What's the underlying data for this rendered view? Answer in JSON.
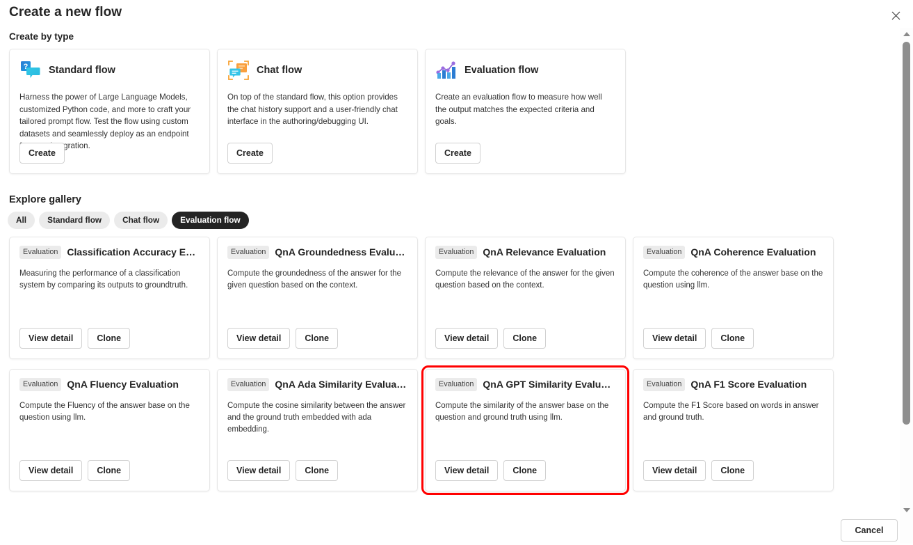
{
  "dialog": {
    "title": "Create a new flow",
    "close_label": "Close",
    "cancel_label": "Cancel"
  },
  "create_by_type": {
    "section_label": "Create by type",
    "cards": [
      {
        "icon": "question-speech-bubble-icon",
        "name": "Standard flow",
        "description": "Harness the power of Large Language Models, customized Python code, and more to craft your tailored prompt flow. Test the flow using custom datasets and seamlessly deploy as an endpoint for easy integration.",
        "button": "Create"
      },
      {
        "icon": "chat-bubbles-icon",
        "name": "Chat flow",
        "description": "On top of the standard flow, this option provides the chat history support and a user-friendly chat interface in the authoring/debugging UI.",
        "button": "Create"
      },
      {
        "icon": "bar-chart-line-icon",
        "name": "Evaluation flow",
        "description": "Create an evaluation flow to measure how well the output matches the expected criteria and goals.",
        "button": "Create"
      }
    ]
  },
  "explore_gallery": {
    "section_label": "Explore gallery",
    "filters": [
      {
        "label": "All",
        "selected": false
      },
      {
        "label": "Standard flow",
        "selected": false
      },
      {
        "label": "Chat flow",
        "selected": false
      },
      {
        "label": "Evaluation flow",
        "selected": true
      }
    ],
    "actions": {
      "view_detail": "View detail",
      "clone": "Clone"
    },
    "cards": [
      {
        "badge": "Evaluation",
        "title": "Classification Accuracy Evalu...",
        "description": "Measuring the performance of a classification system by comparing its outputs to groundtruth.",
        "view_detail": "View detail",
        "clone": "Clone",
        "highlighted": false
      },
      {
        "badge": "Evaluation",
        "title": "QnA Groundedness Evaluation",
        "description": "Compute the groundedness of the answer for the given question based on the context.",
        "view_detail": "View detail",
        "clone": "Clone",
        "highlighted": false
      },
      {
        "badge": "Evaluation",
        "title": "QnA Relevance Evaluation",
        "description": "Compute the relevance of the answer for the given question based on the context.",
        "view_detail": "View detail",
        "clone": "Clone",
        "highlighted": false
      },
      {
        "badge": "Evaluation",
        "title": "QnA Coherence Evaluation",
        "description": "Compute the coherence of the answer base on the question using llm.",
        "view_detail": "View detail",
        "clone": "Clone",
        "highlighted": false
      },
      {
        "badge": "Evaluation",
        "title": "QnA Fluency Evaluation",
        "description": "Compute the Fluency of the answer base on the question using llm.",
        "view_detail": "View detail",
        "clone": "Clone",
        "highlighted": false
      },
      {
        "badge": "Evaluation",
        "title": "QnA Ada Similarity Evaluation",
        "description": "Compute the cosine similarity between the answer and the ground truth embedded with ada embedding.",
        "view_detail": "View detail",
        "clone": "Clone",
        "highlighted": false
      },
      {
        "badge": "Evaluation",
        "title": "QnA GPT Similarity Evaluation",
        "description": "Compute the similarity of the answer base on the question and ground truth using llm.",
        "view_detail": "View detail",
        "clone": "Clone",
        "highlighted": true
      },
      {
        "badge": "Evaluation",
        "title": "QnA F1 Score Evaluation",
        "description": "Compute the F1 Score based on words in answer and ground truth.",
        "view_detail": "View detail",
        "clone": "Clone",
        "highlighted": false
      }
    ]
  },
  "scrollbar": {
    "up_icon": "chevron-up-icon",
    "down_icon": "chevron-down-icon"
  },
  "colors": {
    "highlight": "#ff0000",
    "selected_pill": "#242424",
    "pill_bg": "#ebebeb",
    "card_border": "#e6e6e6"
  }
}
